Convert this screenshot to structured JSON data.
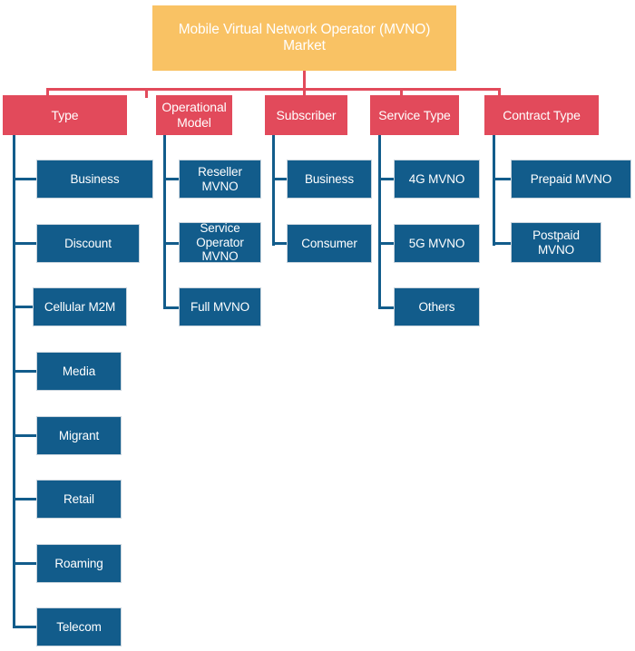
{
  "diagram": {
    "title": "Mobile Virtual Network Operator (MVNO) Market",
    "colors": {
      "root": "#f9c264",
      "category": "#e24a5b",
      "leaf": "#125c8b",
      "text": "#ffffff",
      "background": "#ffffff"
    },
    "branches": [
      {
        "label": "Type",
        "children": [
          {
            "label": "Business"
          },
          {
            "label": "Discount"
          },
          {
            "label": "Cellular M2M"
          },
          {
            "label": "Media"
          },
          {
            "label": "Migrant"
          },
          {
            "label": "Retail"
          },
          {
            "label": "Roaming"
          },
          {
            "label": "Telecom"
          }
        ]
      },
      {
        "label": "Operational Model",
        "children": [
          {
            "label": "Reseller MVNO"
          },
          {
            "label": "Service Operator MVNO"
          },
          {
            "label": "Full MVNO"
          }
        ]
      },
      {
        "label": "Subscriber",
        "children": [
          {
            "label": "Business"
          },
          {
            "label": "Consumer"
          }
        ]
      },
      {
        "label": "Service Type",
        "children": [
          {
            "label": "4G MVNO"
          },
          {
            "label": "5G MVNO"
          },
          {
            "label": "Others"
          }
        ]
      },
      {
        "label": "Contract Type",
        "children": [
          {
            "label": "Prepaid MVNO"
          },
          {
            "label": "Postpaid MVNO"
          }
        ]
      }
    ]
  }
}
